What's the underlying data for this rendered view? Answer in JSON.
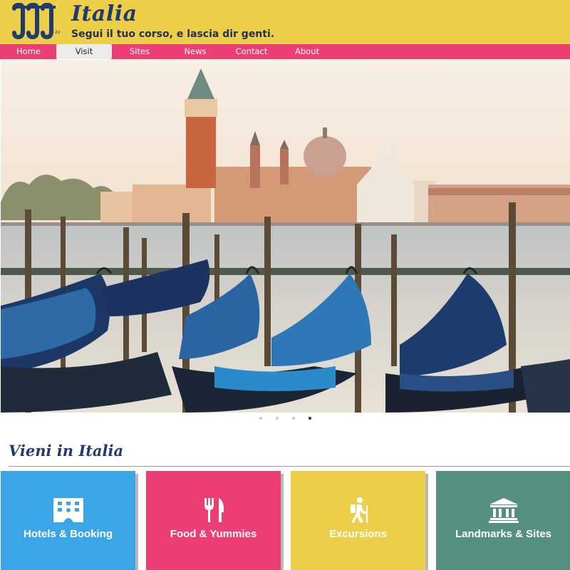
{
  "header": {
    "brand_title": "Italia",
    "logo_suffix": "2x",
    "tagline": "Segui il tuo corso, e lascia dir genti.",
    "bg_color": "#ecce49",
    "text_color": "#233a6e"
  },
  "nav": {
    "bg_color": "#ec3e74",
    "items": [
      {
        "label": "Home",
        "active": false
      },
      {
        "label": "Visit",
        "active": true
      },
      {
        "label": "Sites",
        "active": false
      },
      {
        "label": "News",
        "active": false
      },
      {
        "label": "Contact",
        "active": false
      },
      {
        "label": "About",
        "active": false
      }
    ]
  },
  "hero": {
    "carousel_slide_count": 4,
    "active_slide": 4
  },
  "section": {
    "title": "Vieni in Italia"
  },
  "tiles": [
    {
      "label": "Hotels & Booking",
      "icon": "hotel-icon",
      "color": "#3aa5e7"
    },
    {
      "label": "Food & Yummies",
      "icon": "fork-knife-icon",
      "color": "#ec3e74"
    },
    {
      "label": "Excursions",
      "icon": "hiker-icon",
      "color": "#ecce49"
    },
    {
      "label": "Landmarks & Sites",
      "icon": "landmark-icon",
      "color": "#548f7f"
    }
  ]
}
